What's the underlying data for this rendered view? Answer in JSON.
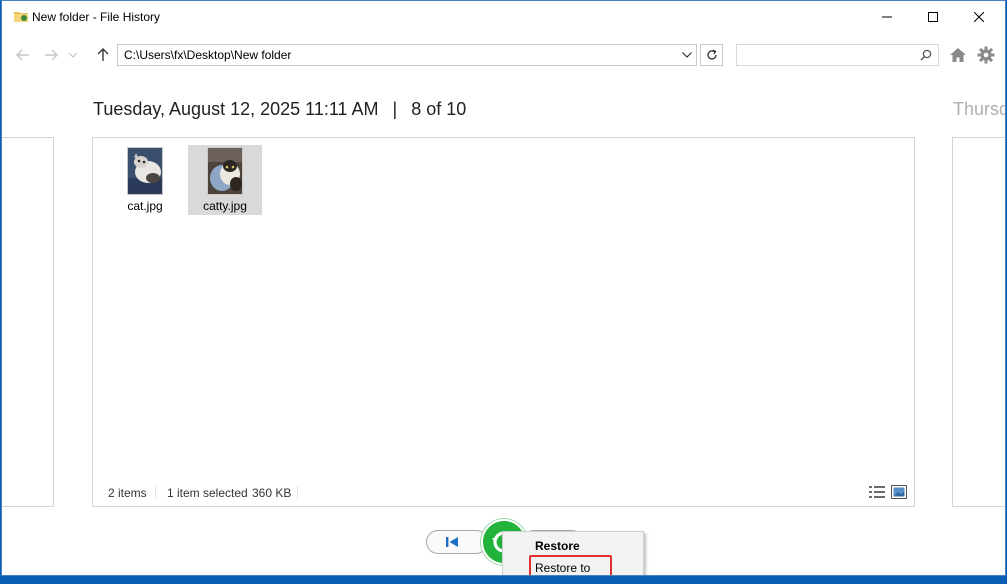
{
  "window": {
    "title": "New folder - File History"
  },
  "navbar": {
    "address": "C:\\Users\\fx\\Desktop\\New folder",
    "search_placeholder": ""
  },
  "header": {
    "date": "Tuesday, August 12, 2025 11:11 AM",
    "separator": "|",
    "position": "8 of 10",
    "next_date_partial": "Thursd"
  },
  "files": [
    {
      "name": "cat.jpg",
      "selected": false
    },
    {
      "name": "catty.jpg",
      "selected": true
    }
  ],
  "status": {
    "items": "2 items",
    "selected": "1 item selected",
    "size": "360 KB"
  },
  "context_menu": {
    "restore": "Restore",
    "restore_to": "Restore to"
  },
  "colors": {
    "restore_green": "#21b33a",
    "highlight_red": "#e0302d",
    "accent_blue": "#1e6fc8"
  }
}
